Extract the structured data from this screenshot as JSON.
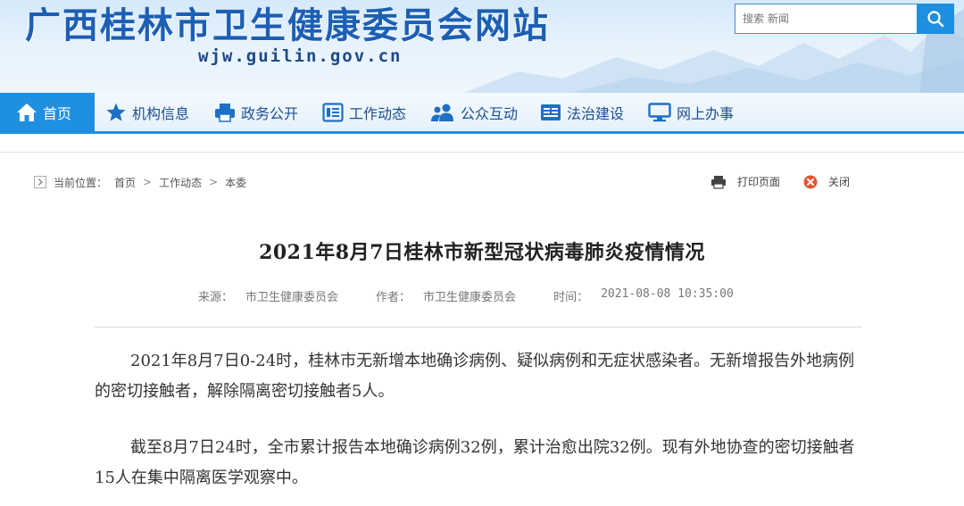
{
  "header": {
    "site_title": "广西桂林市卫生健康委员会网站",
    "site_url": "wjw.guilin.gov.cn",
    "search_placeholder": "搜索 新闻",
    "accent_color": "#1f8fe0"
  },
  "nav": {
    "items": [
      {
        "label": "首页",
        "icon": "home-icon",
        "active": true
      },
      {
        "label": "机构信息",
        "icon": "star-icon"
      },
      {
        "label": "政务公开",
        "icon": "printer-icon"
      },
      {
        "label": "工作动态",
        "icon": "list-icon"
      },
      {
        "label": "公众互动",
        "icon": "users-icon"
      },
      {
        "label": "法治建设",
        "icon": "law-icon"
      },
      {
        "label": "网上办事",
        "icon": "monitor-icon"
      }
    ]
  },
  "breadcrumb": {
    "prefix": "当前位置：",
    "items": [
      "首页",
      "工作动态",
      "本委"
    ],
    "separator": ">"
  },
  "tools": {
    "print_label": "打印页面",
    "close_label": "关闭"
  },
  "article": {
    "title": "2021年8月7日桂林市新型冠状病毒肺炎疫情情况",
    "source_label": "来源：",
    "source": "市卫生健康委员会",
    "author_label": "作者：",
    "author": "市卫生健康委员会",
    "time_label": "时间：",
    "time": "2021-08-08 10:35:00",
    "paragraphs": [
      "2021年8月7日0-24时，桂林市无新增本地确诊病例、疑似病例和无症状感染者。无新增报告外地病例的密切接触者，解除隔离密切接触者5人。",
      "截至8月7日24时，全市累计报告本地确诊病例32例，累计治愈出院32例。现有外地协查的密切接触者15人在集中隔离医学观察中。"
    ]
  }
}
